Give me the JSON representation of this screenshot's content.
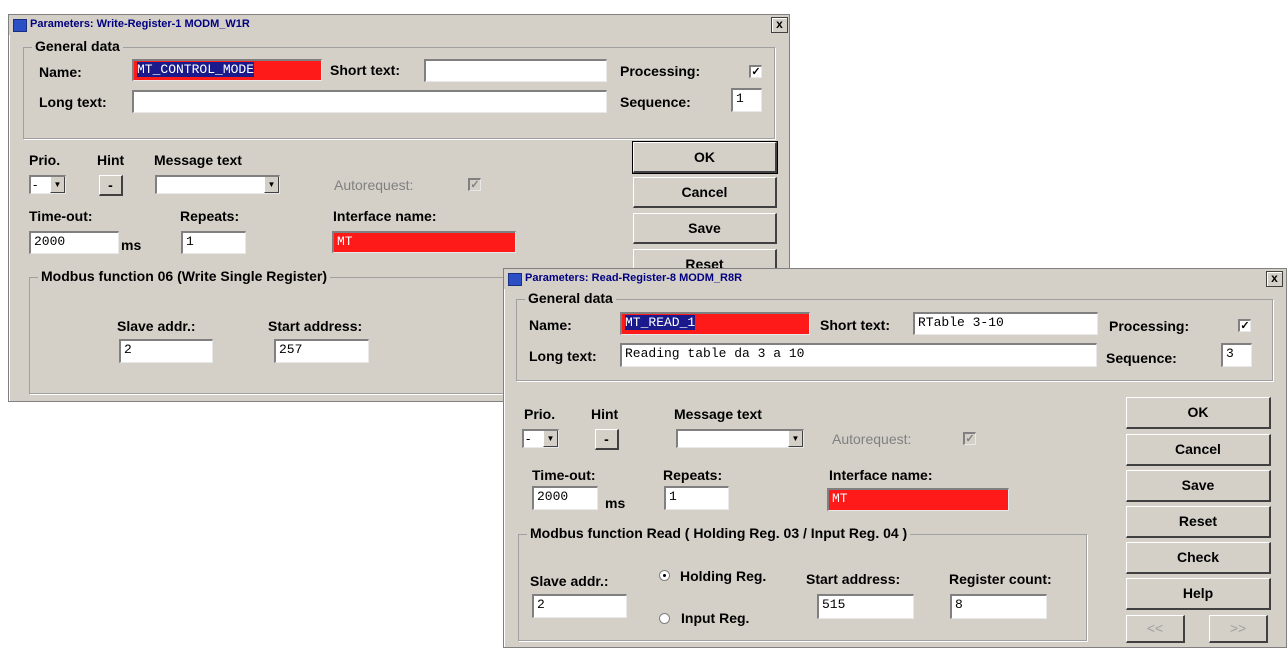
{
  "dialog1": {
    "title": "Parameters: Write-Register-1  MODM_W1R",
    "close": "x",
    "general_group": "General data",
    "name_label": "Name:",
    "name_value": "MT_CONTROL_MODE",
    "short_text_label": "Short text:",
    "short_text_value": "",
    "processing_label": "Processing:",
    "processing_check": "✓",
    "long_text_label": "Long text:",
    "long_text_value": "",
    "sequence_label": "Sequence:",
    "sequence_value": "1",
    "prio_label": "Prio.",
    "prio_value": "-",
    "hint_label": "Hint",
    "hint_button": "-",
    "message_text_label": "Message text",
    "message_text_value": "",
    "autorequest_label": "Autorequest:",
    "autorequest_check": "✓",
    "timeout_label": "Time-out:",
    "timeout_value": "2000",
    "ms_label": "ms",
    "repeats_label": "Repeats:",
    "repeats_value": "1",
    "interface_label": "Interface name:",
    "interface_value": "MT",
    "buttons": {
      "ok": "OK",
      "cancel": "Cancel",
      "save": "Save",
      "reset": "Reset"
    },
    "modbus_group": "Modbus function 06 (Write Single Register)",
    "slave_label": "Slave addr.:",
    "slave_value": "2",
    "start_label": "Start address:",
    "start_value": "257"
  },
  "dialog2": {
    "title": "Parameters: Read-Register-8  MODM_R8R",
    "close": "x",
    "general_group": "General data",
    "name_label": "Name:",
    "name_value": "MT_READ_1",
    "short_text_label": "Short text:",
    "short_text_value": "RTable 3-10",
    "processing_label": "Processing:",
    "processing_check": "✓",
    "long_text_label": "Long text:",
    "long_text_value": "Reading table da 3 a 10",
    "sequence_label": "Sequence:",
    "sequence_value": "3",
    "prio_label": "Prio.",
    "prio_value": "-",
    "hint_label": "Hint",
    "hint_button": "-",
    "message_text_label": "Message text",
    "message_text_value": "",
    "autorequest_label": "Autorequest:",
    "autorequest_check": "✓",
    "timeout_label": "Time-out:",
    "timeout_value": "2000",
    "ms_label": "ms",
    "repeats_label": "Repeats:",
    "repeats_value": "1",
    "interface_label": "Interface name:",
    "interface_value": "MT",
    "buttons": {
      "ok": "OK",
      "cancel": "Cancel",
      "save": "Save",
      "reset": "Reset",
      "check": "Check",
      "help": "Help",
      "prev": "<<",
      "next": ">>"
    },
    "modbus_group": "Modbus function Read ( Holding Reg. 03 / Input Reg. 04 )",
    "slave_label": "Slave addr.:",
    "slave_value": "2",
    "holding_label": "Holding Reg.",
    "input_label": "Input Reg.",
    "start_label": "Start address:",
    "start_value": "515",
    "count_label": "Register count:",
    "count_value": "8"
  },
  "colors": {
    "dialog_bg": "#d4d0c8",
    "required_field": "#ff1a1a",
    "title_text": "#000080"
  }
}
